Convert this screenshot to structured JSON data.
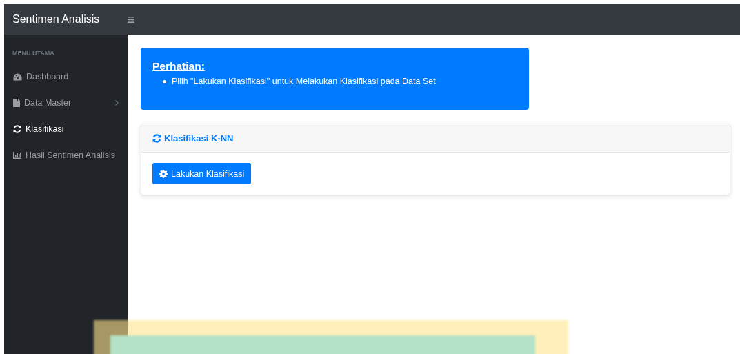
{
  "navbar": {
    "brand": "Sentimen Analisis"
  },
  "sidebar": {
    "heading": "MENU UTAMA",
    "items": [
      {
        "label": "Dashboard",
        "selected": false,
        "has_submenu": false
      },
      {
        "label": "Data Master",
        "selected": false,
        "has_submenu": true
      },
      {
        "label": "Klasifikasi",
        "selected": true,
        "has_submenu": false
      },
      {
        "label": "Hasil Sentimen Analisis",
        "selected": false,
        "has_submenu": false
      }
    ]
  },
  "alert": {
    "title": "Perhatian:",
    "items": [
      "Pilih \"Lakukan Klasifikasi\" untuk Melakukan Klasifikasi pada Data Set"
    ]
  },
  "card": {
    "title": "Klasifikasi K-NN",
    "button": "Lakukan Klasifikasi"
  }
}
